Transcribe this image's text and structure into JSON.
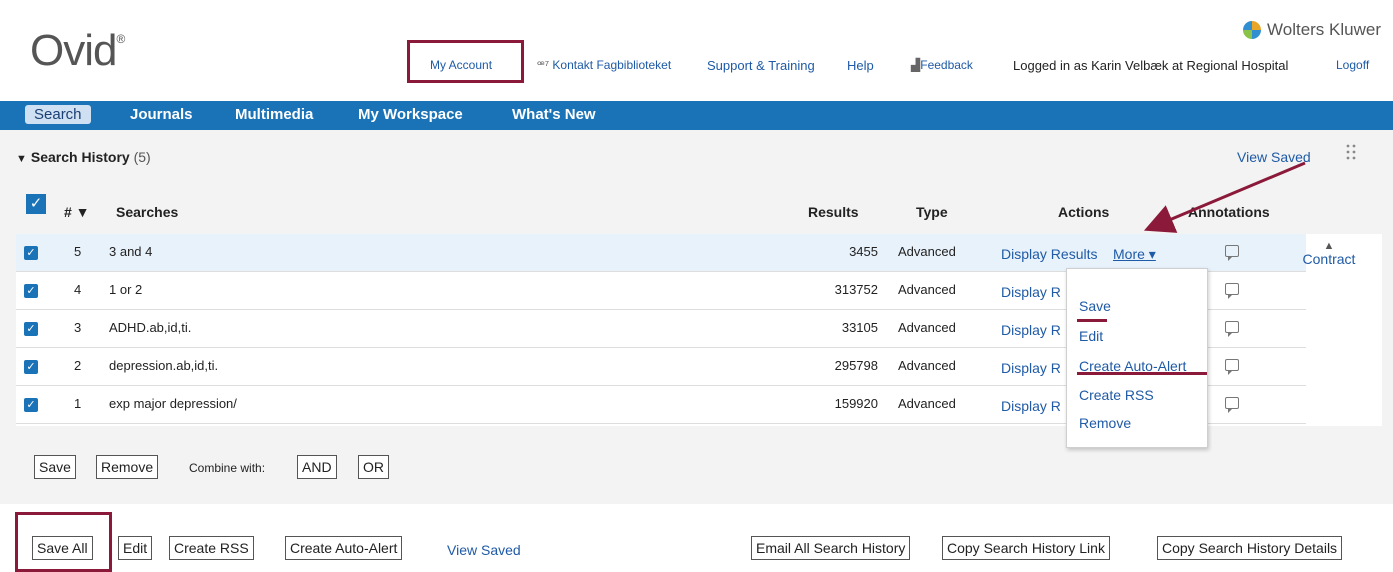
{
  "header": {
    "logo_text": "Ovid",
    "logo_mark": "®",
    "brand": "Wolters Kluwer",
    "nav": {
      "my_account": "My Account",
      "kontakt": "Kontakt Fagbiblioteket",
      "support": "Support & Training",
      "help": "Help",
      "feedback": "Feedback",
      "logged_in": "Logged in as Karin Velbæk at Regional Hospital",
      "logoff": "Logoff"
    }
  },
  "mainnav": {
    "items": [
      "Search",
      "Journals",
      "Multimedia",
      "My Workspace",
      "What's New"
    ]
  },
  "history": {
    "title": "Search History",
    "count": "(5)",
    "view_saved": "View Saved",
    "columns": {
      "num": "# ▼",
      "searches": "Searches",
      "results": "Results",
      "type": "Type",
      "actions": "Actions",
      "annotations": "Annotations"
    },
    "rows": [
      {
        "num": "5",
        "search": "3 and 4",
        "results": "3455",
        "type": "Advanced",
        "action": "Display Results",
        "more": "More ▾"
      },
      {
        "num": "4",
        "search": "1 or 2",
        "results": "313752",
        "type": "Advanced",
        "action": "Display R"
      },
      {
        "num": "3",
        "search": "ADHD.ab,id,ti.",
        "results": "33105",
        "type": "Advanced",
        "action": "Display R"
      },
      {
        "num": "2",
        "search": "depression.ab,id,ti.",
        "results": "295798",
        "type": "Advanced",
        "action": "Display R"
      },
      {
        "num": "1",
        "search": "exp major depression/",
        "results": "159920",
        "type": "Advanced",
        "action": "Display R"
      }
    ],
    "contract": "Contract",
    "contract_arrow": "▲",
    "buttons": {
      "save": "Save",
      "remove": "Remove",
      "combine_label": "Combine with:",
      "and": "AND",
      "or": "OR"
    }
  },
  "dropdown": {
    "items": [
      "Save",
      "Edit",
      "Create Auto-Alert",
      "Create RSS",
      "Remove"
    ]
  },
  "bottom": {
    "save_all": "Save All",
    "edit": "Edit",
    "create_rss": "Create RSS",
    "create_auto_alert": "Create Auto-Alert",
    "view_saved": "View Saved",
    "email_all": "Email All Search History",
    "copy_link": "Copy Search History Link",
    "copy_details": "Copy Search History Details"
  },
  "colors": {
    "nav_blue": "#1a73b7",
    "link_blue": "#1f5aa6",
    "highlight_maroon": "#8b1a3a"
  }
}
